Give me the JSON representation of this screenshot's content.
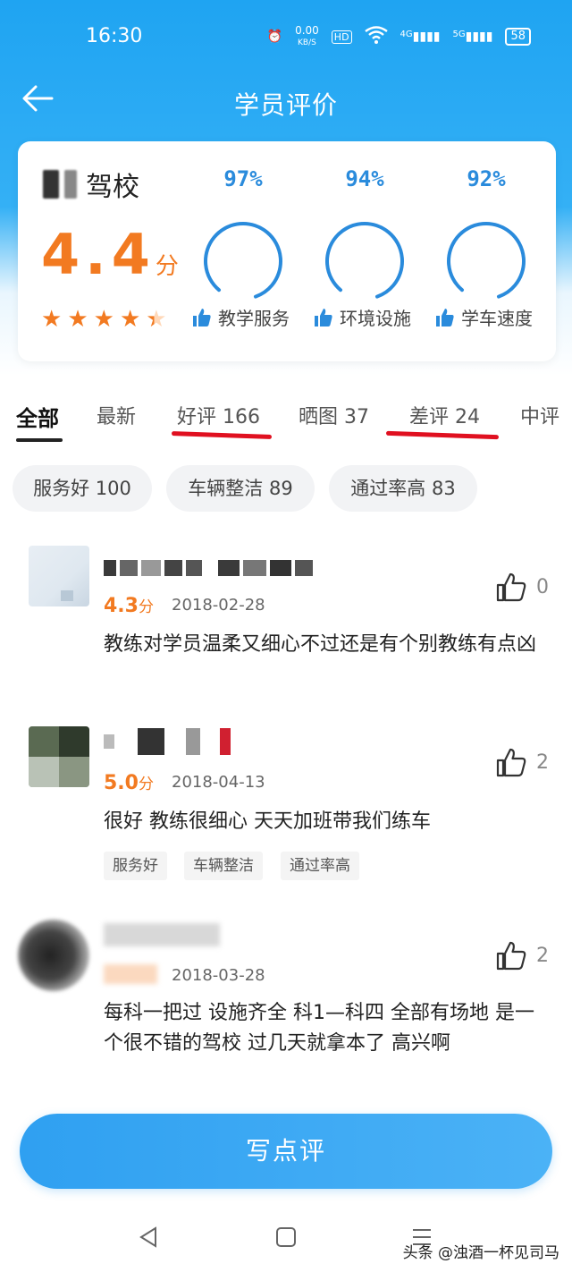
{
  "status": {
    "time": "16:30",
    "speed": "0.00",
    "speed_unit": "KB/S",
    "hd": "HD",
    "net1": "4G",
    "net2": "5G",
    "battery": "58"
  },
  "nav": {
    "title": "学员评价",
    "back_icon": "arrow-left-icon"
  },
  "school": {
    "name": "驾校",
    "rating": "4.4",
    "rating_unit": "分",
    "stars": 4.4,
    "metrics": [
      {
        "percent": "97%",
        "value": 0.97,
        "label": "教学服务"
      },
      {
        "percent": "94%",
        "value": 0.94,
        "label": "环境设施"
      },
      {
        "percent": "92%",
        "value": 0.92,
        "label": "学车速度"
      }
    ]
  },
  "tabs": [
    {
      "label": "全部"
    },
    {
      "label": "最新"
    },
    {
      "label": "好评 166"
    },
    {
      "label": "晒图 37"
    },
    {
      "label": "差评 24"
    },
    {
      "label": "中评"
    }
  ],
  "filters": [
    {
      "label": "服务好 100"
    },
    {
      "label": "车辆整洁 89"
    },
    {
      "label": "通过率高 83"
    }
  ],
  "reviews": [
    {
      "score": "4.3",
      "unit": "分",
      "date": "2018-02-28",
      "likes": "0",
      "text": "教练对学员温柔又细心不过还是有个别教练有点凶"
    },
    {
      "score": "5.0",
      "unit": "分",
      "date": "2018-04-13",
      "likes": "2",
      "text": "很好 教练很细心 天天加班带我们练车",
      "tags": [
        "服务好",
        "车辆整洁",
        "通过率高"
      ]
    },
    {
      "score": "",
      "unit": "",
      "date": "2018-03-28",
      "likes": "2",
      "text": "每科一把过  设施齐全  科1—科四  全部有场地  是一个很不错的驾校   过几天就拿本了  高兴啊"
    }
  ],
  "write_button": "写点评",
  "watermark": "头条 @浊酒一杯见司马",
  "colors": {
    "primary": "#1fa4f2",
    "accent": "#f27a21",
    "gauge": "#2a8bdc",
    "highlight": "#e01020"
  }
}
